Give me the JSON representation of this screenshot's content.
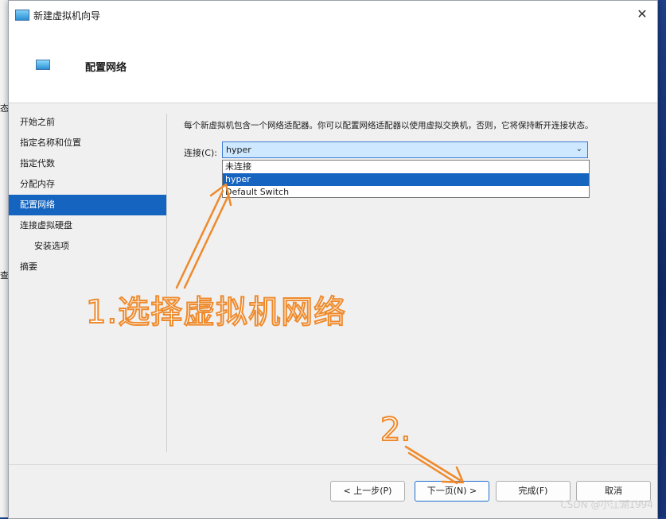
{
  "window": {
    "title": "新建虚拟机向导",
    "close_glyph": "✕",
    "header_title": "配置网络"
  },
  "nav": {
    "items": [
      {
        "label": "开始之前"
      },
      {
        "label": "指定名称和位置"
      },
      {
        "label": "指定代数"
      },
      {
        "label": "分配内存"
      },
      {
        "label": "配置网络"
      },
      {
        "label": "连接虚拟硬盘"
      },
      {
        "label": "安装选项"
      },
      {
        "label": "摘要"
      }
    ]
  },
  "main": {
    "description": "每个新虚拟机包含一个网络适配器。你可以配置网络适配器以使用虚拟交换机，否则，它将保持断开连接状态。",
    "connection_label": "连接(C):",
    "connection_value": "hyper",
    "options": [
      "未连接",
      "hyper",
      "Default Switch"
    ]
  },
  "buttons": {
    "prev": "< 上一步(P)",
    "next": "下一页(N) >",
    "finish": "完成(F)",
    "cancel": "取消"
  },
  "annotations": {
    "step1": "1.选择虚拟机网络",
    "step2": "2."
  },
  "background": {
    "left_text_1": "态",
    "left_text_2": "查"
  },
  "watermark": "CSDN @小江湖1994",
  "colors": {
    "accent": "#1565c0",
    "annotation": "#ee8a2c"
  }
}
